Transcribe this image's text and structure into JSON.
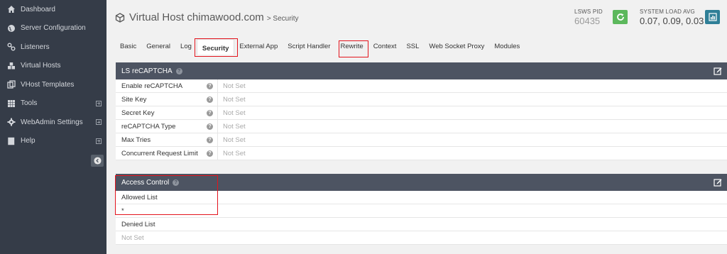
{
  "sidebar": {
    "items": [
      {
        "label": "Dashboard",
        "icon": "home-icon",
        "expandable": false
      },
      {
        "label": "Server Configuration",
        "icon": "globe-icon",
        "expandable": false
      },
      {
        "label": "Listeners",
        "icon": "link-icon",
        "expandable": false
      },
      {
        "label": "Virtual Hosts",
        "icon": "cubes-icon",
        "expandable": false
      },
      {
        "label": "VHost Templates",
        "icon": "copy-icon",
        "expandable": false
      },
      {
        "label": "Tools",
        "icon": "grid-icon",
        "expandable": true
      },
      {
        "label": "WebAdmin Settings",
        "icon": "gear-icon",
        "expandable": true
      },
      {
        "label": "Help",
        "icon": "book-icon",
        "expandable": true
      }
    ]
  },
  "header": {
    "title": "Virtual Host chimawood.com",
    "crumb": "> Security",
    "pid_label": "LSWS PID",
    "pid_value": "60435",
    "load_label": "SYSTEM LOAD AVG",
    "load_value": "0.07, 0.09, 0.03"
  },
  "tabs": [
    {
      "label": "Basic",
      "active": false
    },
    {
      "label": "General",
      "active": false
    },
    {
      "label": "Log",
      "active": false
    },
    {
      "label": "Security",
      "active": true
    },
    {
      "label": "External App",
      "active": false
    },
    {
      "label": "Script Handler",
      "active": false
    },
    {
      "label": "Rewrite",
      "active": false
    },
    {
      "label": "Context",
      "active": false
    },
    {
      "label": "SSL",
      "active": false
    },
    {
      "label": "Web Socket Proxy",
      "active": false
    },
    {
      "label": "Modules",
      "active": false
    }
  ],
  "recaptcha": {
    "title": "LS reCAPTCHA",
    "rows": [
      {
        "key": "Enable reCAPTCHA",
        "value": "Not Set"
      },
      {
        "key": "Site Key",
        "value": "Not Set"
      },
      {
        "key": "Secret Key",
        "value": "Not Set"
      },
      {
        "key": "reCAPTCHA Type",
        "value": "Not Set"
      },
      {
        "key": "Max Tries",
        "value": "Not Set"
      },
      {
        "key": "Concurrent Request Limit",
        "value": "Not Set"
      }
    ]
  },
  "access": {
    "title": "Access Control",
    "allowed_label": "Allowed List",
    "allowed_value": "*",
    "denied_label": "Denied List",
    "denied_value": "Not Set"
  },
  "colors": {
    "sidebar_bg": "#353c48",
    "panel_header": "#4d5462",
    "highlight": "#e3141d",
    "pid_button": "#5cb85c",
    "load_button": "#2f7f97"
  }
}
